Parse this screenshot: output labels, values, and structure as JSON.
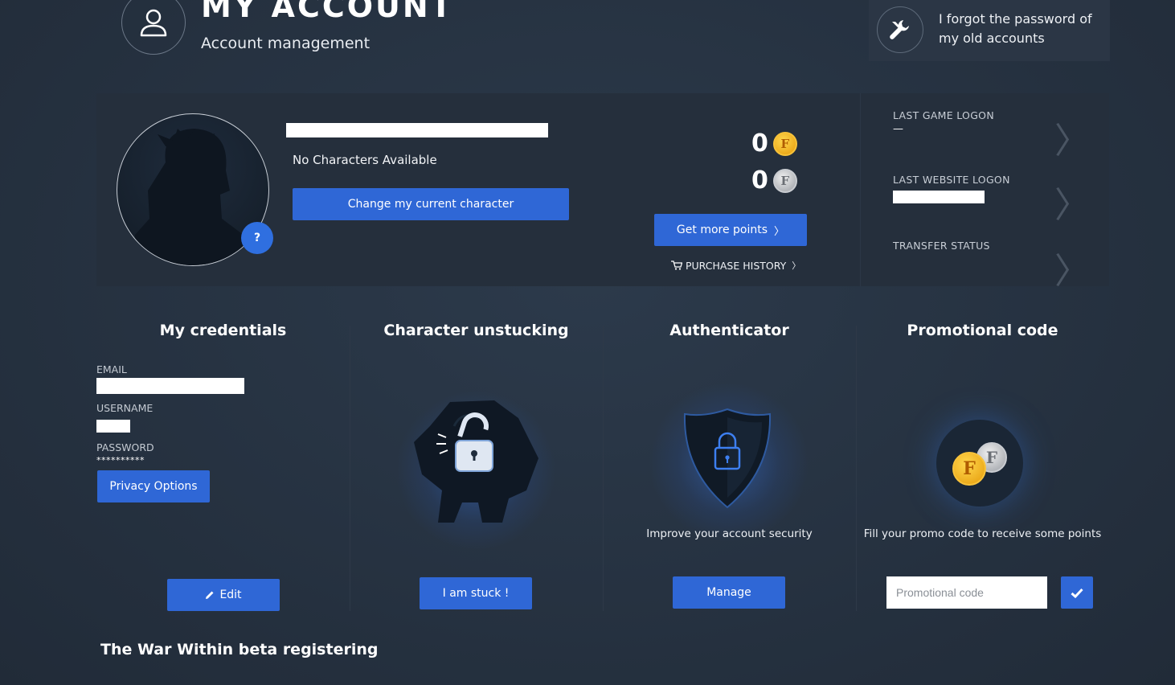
{
  "header": {
    "title": "MY ACCOUNT",
    "subtitle": "Account management",
    "forgot_text": "I forgot the password of my old accounts"
  },
  "profile": {
    "no_characters": "No Characters Available",
    "change_character_label": "Change my current character",
    "help_label": "?"
  },
  "points": {
    "gold_points": "0",
    "silver_points": "0",
    "gold_coin_letter": "F",
    "silver_coin_letter": "F",
    "get_more_label": "Get more points",
    "purchase_history_label": "PURCHASE HISTORY"
  },
  "logons": {
    "last_game_label": "LAST GAME LOGON",
    "last_game_value": "—",
    "last_website_label": "LAST WEBSITE LOGON",
    "transfer_label": "TRANSFER STATUS"
  },
  "credentials": {
    "title": "My credentials",
    "email_label": "EMAIL",
    "username_label": "USERNAME",
    "password_label": "PASSWORD",
    "password_value": "**********",
    "privacy_label": "Privacy Options",
    "edit_label": "Edit"
  },
  "unstuck": {
    "title": "Character unstucking",
    "button_label": "I am stuck !"
  },
  "authenticator": {
    "title": "Authenticator",
    "description": "Improve your account security",
    "button_label": "Manage"
  },
  "promo": {
    "title": "Promotional code",
    "description": "Fill your promo code to receive some points",
    "placeholder": "Promotional code",
    "gold_coin_letter": "F",
    "silver_coin_letter": "F"
  },
  "beta": {
    "title": "The War Within beta registering"
  },
  "colors": {
    "accent": "#2f67d6",
    "background": "#263241",
    "panel": "#252f3c"
  }
}
